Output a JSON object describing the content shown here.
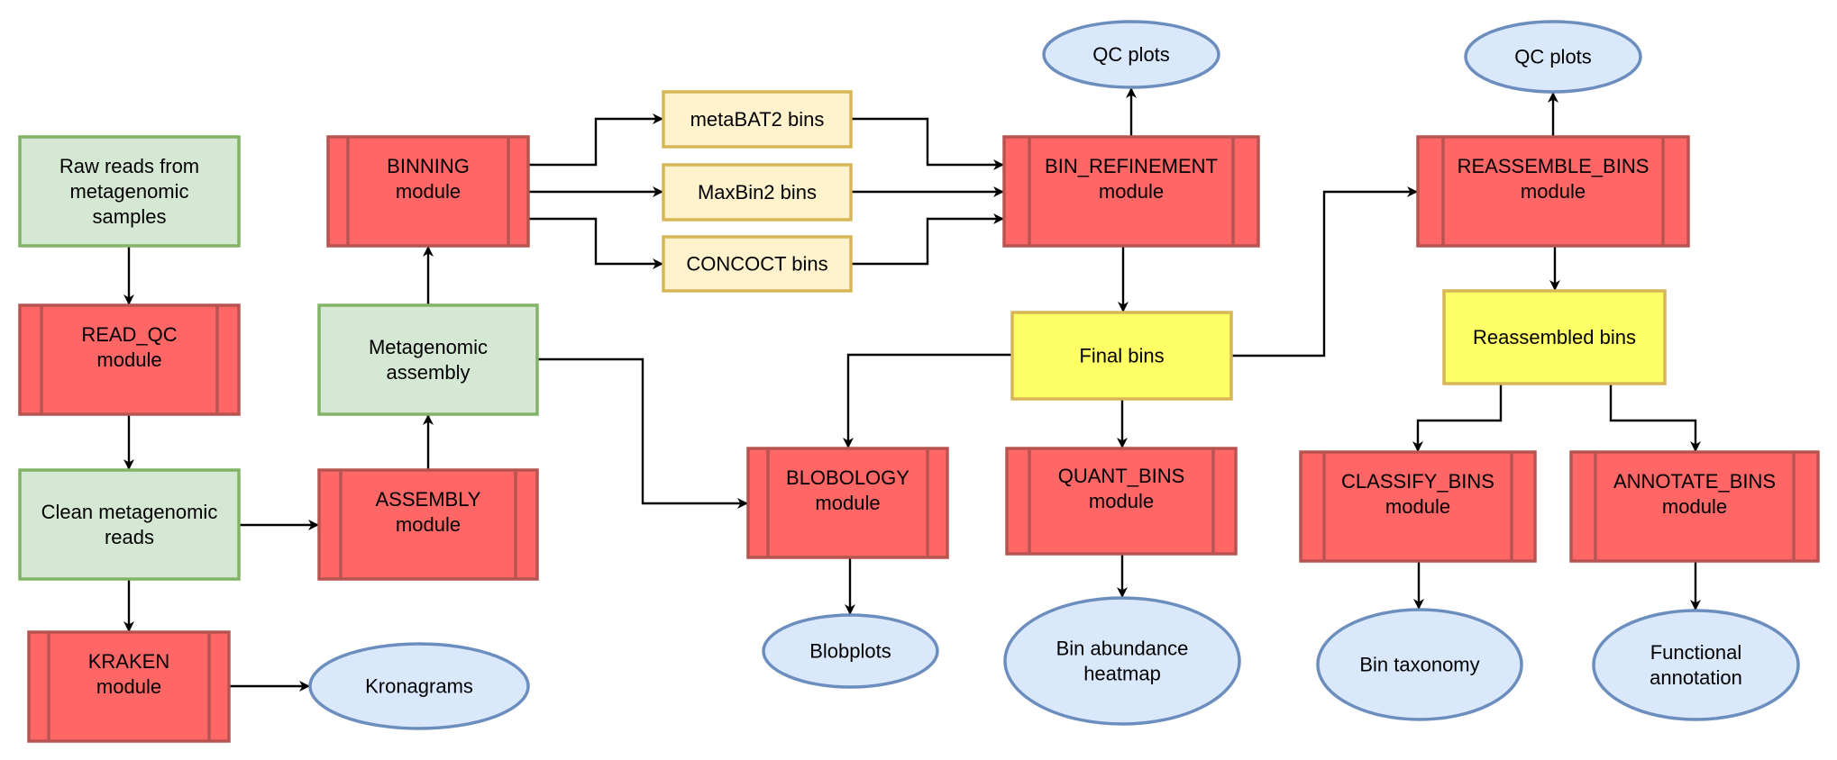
{
  "diagram": {
    "type": "flowchart",
    "palette": {
      "module_fill": "#ff6666",
      "module_stroke": "#b85450",
      "input_fill": "#d5e8d4",
      "input_stroke": "#82b366",
      "bins_fill": "#fff2cc",
      "bins_stroke": "#d6b656",
      "final_fill": "#ffff66",
      "final_stroke": "#d6b656",
      "output_fill": "#dae8fc",
      "output_stroke": "#6c8ebf",
      "edge": "#000000"
    },
    "nodes": [
      {
        "id": "raw_reads",
        "kind": "input",
        "lines": [
          "Raw reads from",
          "metagenomic",
          "samples"
        ]
      },
      {
        "id": "read_qc",
        "kind": "module",
        "lines": [
          "READ_QC",
          "module"
        ]
      },
      {
        "id": "clean_reads",
        "kind": "input",
        "lines": [
          "Clean metagenomic",
          "reads"
        ]
      },
      {
        "id": "kraken",
        "kind": "module",
        "lines": [
          "KRAKEN",
          "module"
        ]
      },
      {
        "id": "kronagrams",
        "kind": "output",
        "lines": [
          "Kronagrams"
        ]
      },
      {
        "id": "assembly",
        "kind": "module",
        "lines": [
          "ASSEMBLY",
          "module"
        ]
      },
      {
        "id": "metagenomic_assembly",
        "kind": "input",
        "lines": [
          "Metagenomic",
          "assembly"
        ]
      },
      {
        "id": "binning",
        "kind": "module",
        "lines": [
          "BINNING",
          "module"
        ]
      },
      {
        "id": "metabat2",
        "kind": "bins",
        "lines": [
          "metaBAT2 bins"
        ]
      },
      {
        "id": "maxbin2",
        "kind": "bins",
        "lines": [
          "MaxBin2 bins"
        ]
      },
      {
        "id": "concoct",
        "kind": "bins",
        "lines": [
          "CONCOCT bins"
        ]
      },
      {
        "id": "bin_refinement",
        "kind": "module",
        "lines": [
          "BIN_REFINEMENT",
          "module"
        ]
      },
      {
        "id": "qc_plots_1",
        "kind": "output",
        "lines": [
          "QC plots"
        ]
      },
      {
        "id": "final_bins",
        "kind": "final",
        "lines": [
          "Final bins"
        ]
      },
      {
        "id": "blobology",
        "kind": "module",
        "lines": [
          "BLOBOLOGY",
          "module"
        ]
      },
      {
        "id": "blobplots",
        "kind": "output",
        "lines": [
          "Blobplots"
        ]
      },
      {
        "id": "quant_bins",
        "kind": "module",
        "lines": [
          "QUANT_BINS",
          "module"
        ]
      },
      {
        "id": "bin_abundance",
        "kind": "output",
        "lines": [
          "Bin abundance",
          "heatmap"
        ]
      },
      {
        "id": "reassemble_bins",
        "kind": "module",
        "lines": [
          "REASSEMBLE_BINS",
          "module"
        ]
      },
      {
        "id": "qc_plots_2",
        "kind": "output",
        "lines": [
          "QC plots"
        ]
      },
      {
        "id": "reassembled_bins",
        "kind": "final",
        "lines": [
          "Reassembled bins"
        ]
      },
      {
        "id": "classify_bins",
        "kind": "module",
        "lines": [
          "CLASSIFY_BINS",
          "module"
        ]
      },
      {
        "id": "annotate_bins",
        "kind": "module",
        "lines": [
          "ANNOTATE_BINS",
          "module"
        ]
      },
      {
        "id": "bin_taxonomy",
        "kind": "output",
        "lines": [
          "Bin taxonomy"
        ]
      },
      {
        "id": "functional_annotation",
        "kind": "output",
        "lines": [
          "Functional",
          "annotation"
        ]
      }
    ],
    "edges": [
      {
        "from": "raw_reads",
        "to": "read_qc"
      },
      {
        "from": "read_qc",
        "to": "clean_reads"
      },
      {
        "from": "clean_reads",
        "to": "kraken"
      },
      {
        "from": "kraken",
        "to": "kronagrams"
      },
      {
        "from": "clean_reads",
        "to": "assembly"
      },
      {
        "from": "assembly",
        "to": "metagenomic_assembly"
      },
      {
        "from": "metagenomic_assembly",
        "to": "binning"
      },
      {
        "from": "metagenomic_assembly",
        "to": "blobology"
      },
      {
        "from": "binning",
        "to": "metabat2"
      },
      {
        "from": "binning",
        "to": "maxbin2"
      },
      {
        "from": "binning",
        "to": "concoct"
      },
      {
        "from": "metabat2",
        "to": "bin_refinement"
      },
      {
        "from": "maxbin2",
        "to": "bin_refinement"
      },
      {
        "from": "concoct",
        "to": "bin_refinement"
      },
      {
        "from": "bin_refinement",
        "to": "qc_plots_1"
      },
      {
        "from": "bin_refinement",
        "to": "final_bins"
      },
      {
        "from": "final_bins",
        "to": "blobology"
      },
      {
        "from": "final_bins",
        "to": "quant_bins"
      },
      {
        "from": "final_bins",
        "to": "reassemble_bins"
      },
      {
        "from": "blobology",
        "to": "blobplots"
      },
      {
        "from": "quant_bins",
        "to": "bin_abundance"
      },
      {
        "from": "reassemble_bins",
        "to": "qc_plots_2"
      },
      {
        "from": "reassemble_bins",
        "to": "reassembled_bins"
      },
      {
        "from": "reassembled_bins",
        "to": "classify_bins"
      },
      {
        "from": "reassembled_bins",
        "to": "annotate_bins"
      },
      {
        "from": "classify_bins",
        "to": "bin_taxonomy"
      },
      {
        "from": "annotate_bins",
        "to": "functional_annotation"
      }
    ]
  }
}
